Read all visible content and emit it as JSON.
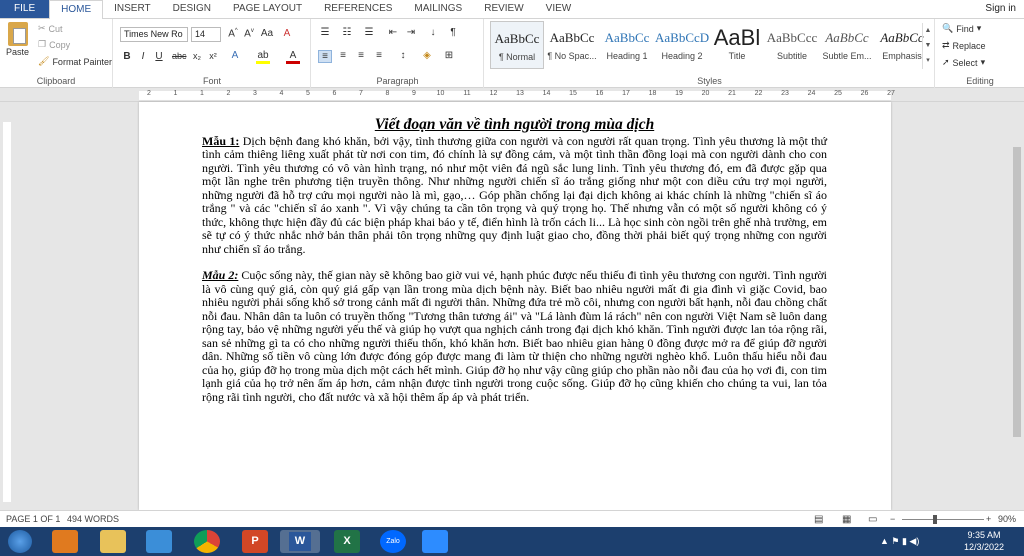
{
  "tabs": [
    "FILE",
    "HOME",
    "INSERT",
    "DESIGN",
    "PAGE LAYOUT",
    "REFERENCES",
    "MAILINGS",
    "REVIEW",
    "VIEW"
  ],
  "signin": "Sign in",
  "clipboard": {
    "paste": "Paste",
    "cut": "Cut",
    "copy": "Copy",
    "format_painter": "Format Painter",
    "label": "Clipboard"
  },
  "font": {
    "name": "Times New Ro",
    "size": "14",
    "label": "Font"
  },
  "paragraph": {
    "label": "Paragraph"
  },
  "styles": {
    "label": "Styles",
    "items": [
      {
        "preview": "AaBbCc",
        "name": "¶ Normal"
      },
      {
        "preview": "AaBbCc",
        "name": "¶ No Spac..."
      },
      {
        "preview": "AaBbCc",
        "name": "Heading 1"
      },
      {
        "preview": "AaBbCcD",
        "name": "Heading 2"
      },
      {
        "preview": "AaBl",
        "name": "Title"
      },
      {
        "preview": "AaBbCcc",
        "name": "Subtitle"
      },
      {
        "preview": "AaBbCc",
        "name": "Subtle Em..."
      },
      {
        "preview": "AaBbCc",
        "name": "Emphasis"
      }
    ]
  },
  "editing": {
    "find": "Find",
    "replace": "Replace",
    "select": "Select",
    "label": "Editing"
  },
  "ruler_numbers": [
    "2",
    "1",
    "1",
    "2",
    "3",
    "4",
    "5",
    "6",
    "7",
    "8",
    "9",
    "10",
    "11",
    "12",
    "13",
    "14",
    "15",
    "16",
    "17",
    "18",
    "19",
    "20",
    "21",
    "22",
    "23",
    "24",
    "25",
    "26",
    "27"
  ],
  "document": {
    "title": "Viết đoạn văn về tình người trong mùa dịch",
    "p1_label": "Mẫu 1:",
    "p1_text": " Dịch bệnh đang khó khăn, bởi vậy, tình thương giữa con người và con người rất quan trọng. Tình yêu thương là một thứ tình cảm thiêng liêng xuất phát từ nơi con tim, đó chính là sự đồng cảm, và một tình thần đồng loại mà con người dành cho con người. Tình yêu thương có vô vàn hình trạng, nó như một viên đá ngũ sắc lung linh. Tình yêu thương đó, em đã được gặp qua một lần nghe trên phương tiện truyền thông. Như những người chiến sĩ áo trắng giống như một con diều cứu trợ mọi người, những người đã hỗ trợ cứu mọi người nào là mì, gạo,… Góp phần chống lại đại dịch không ai khác chính là những \"chiến sĩ áo trắng \" và các \"chiến sĩ áo xanh \". Vì vậy chúng ta cần tôn trọng và quý trọng họ. Thế nhưng vẫn có một số người không có ý thức, không thực hiện đầy đủ các biện pháp khai báo y tế, điển hình là trốn cách li... Là học sinh còn ngồi trên ghế nhà trường, em sẽ tự có ý thức nhắc nhở bản thân phải tôn trọng những quy định luật giao cho, đồng thời phải biết quý trọng những con người như chiến sĩ áo trắng.",
    "p2_label": "Mẫu 2:",
    "p2_text": " Cuộc sống này, thế gian này sẽ không bao giờ vui vẻ, hạnh phúc được nếu thiếu đi tình yêu thương con người. Tình người là vô cùng quý giá, còn quý giá gấp vạn lần trong mùa dịch bệnh này. Biết bao nhiêu người mất đi gia đình vì giặc Covid, bao nhiêu người phải sống khổ sở trong cảnh mất đi người thân. Những đứa trẻ mồ côi, nhưng con người bất hạnh, nỗi đau chồng chất nỗi đau. Nhân dân ta luôn có truyền thống \"Tương thân tương ái\" và \"Lá lành đùm lá rách\" nên con người Việt Nam sẽ luôn dang rộng tay, bảo vệ những người yếu thế và giúp họ vượt qua nghịch cảnh trong đại dịch khó khăn. Tình người được lan tỏa rộng rãi, san sẻ những gì ta có cho những người thiếu thốn, khó khăn hơn. Biết bao nhiêu gian hàng 0 đồng được mở ra để giúp đỡ người dân. Những số tiền vô cùng lớn được đóng góp được mang đi làm từ thiện cho những người nghèo khổ. Luôn thấu hiểu nỗi đau của họ, giúp đỡ họ trong mùa dịch một cách hết mình. Giúp đỡ họ như vậy cũng giúp cho phần nào nỗi đau của họ vơi đi, con tim lạnh giá của họ trở nên ấm áp hơn, cảm nhận được tình người trong cuộc sống. Giúp đỡ họ cũng khiến cho chúng ta vui, lan tỏa rộng rãi tình người, cho đất nước và xã hội thêm ấp áp và phát triển."
  },
  "status": {
    "page": "PAGE 1 OF 1",
    "words": "494 WORDS",
    "zoom": "90%"
  },
  "taskbar": {
    "time": "9:35 AM",
    "date": "12/3/2022"
  },
  "colors": {
    "accent": "#2b579a",
    "taskbar": "#1c3f6e"
  }
}
